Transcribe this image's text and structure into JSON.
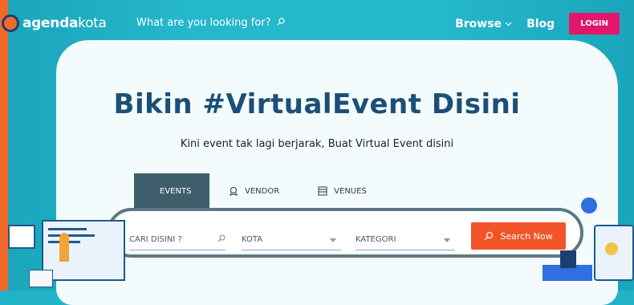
{
  "header": {
    "logo": {
      "bold": "agenda",
      "light": "kota"
    },
    "search_placeholder": "What are you looking for?",
    "nav": {
      "browse": "Browse",
      "blog": "Blog",
      "login": "LOGIN"
    }
  },
  "hero": {
    "title": "Bikin #VirtualEvent Disini",
    "subtitle": "Kini event tak lagi berjarak, Buat Virtual Event disini"
  },
  "tabs": [
    {
      "label": "EVENTS",
      "icon": "calendar-icon",
      "active": true
    },
    {
      "label": "VENDOR",
      "icon": "ribbon-icon",
      "active": false
    },
    {
      "label": "VENUES",
      "icon": "building-icon",
      "active": false
    }
  ],
  "search_form": {
    "keyword_placeholder": "CARI DISINI ?",
    "city_placeholder": "KOTA",
    "category_placeholder": "KATEGORI",
    "button": "Search Now"
  },
  "colors": {
    "background": "#21b4c9",
    "title": "#1c4f76",
    "login": "#e2166a",
    "search_button": "#f2542a",
    "active_tab": "#3e5e6c"
  }
}
